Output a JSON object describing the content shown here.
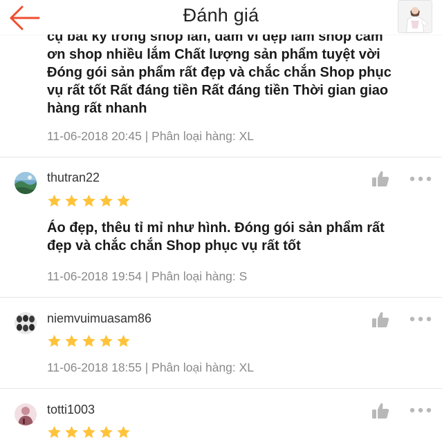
{
  "header": {
    "title": "Đánh giá",
    "back_icon": "arrow-left-icon",
    "accent_color": "#ee4d2d"
  },
  "star_color": "#ffc33b",
  "reviews": [
    {
      "text_clipped_line": "cụ bất kỳ trong shop lần, dám vì đẹp lắm shop cảm",
      "text_lines": [
        "ơn shop nhiều lắm  Chất lượng sản phẩm tuyệt vời",
        "Đóng gói sản phẩm rất đẹp và chắc chắn Shop phục",
        "vụ rất tốt Rất đáng tiền Rất đáng tiền Thời gian giao",
        "hàng rất nhanh"
      ],
      "meta": "11-06-2018 20:45 | Phân loại hàng: XL"
    },
    {
      "username": "thutran22",
      "rating": 5,
      "text_lines": [
        "Áo đẹp, thêu tỉ mỉ như hình. Đóng gói sản phẩm rất",
        "đẹp và chắc chắn Shop phục vụ rất tốt"
      ],
      "meta": "11-06-2018 19:54 | Phân loại hàng: S"
    },
    {
      "username": "niemvuimuasam86",
      "rating": 5,
      "meta": "11-06-2018 18:55 | Phân loại hàng: XL"
    },
    {
      "username": "totti1003",
      "rating": 5
    }
  ]
}
